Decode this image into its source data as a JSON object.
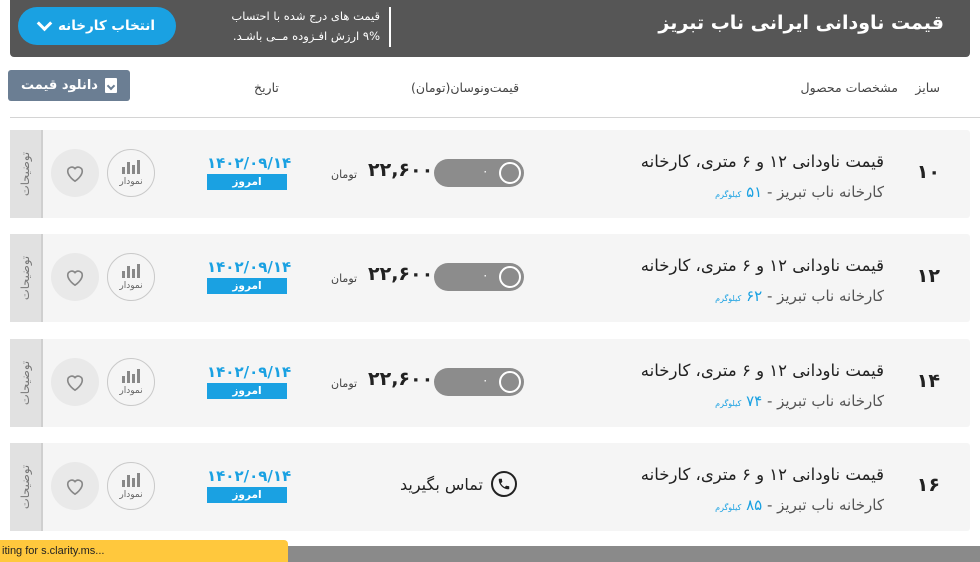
{
  "header": {
    "title": "قیمت ناودانی ایرانی ناب تبریز",
    "note_line1": "قیمت های درج شده با احتساب",
    "note_line2": "۹% ارزش افـزوده مــی باشـد.",
    "factory_button": "انتخاب کارخانه"
  },
  "columns": {
    "size": "سایز",
    "specs": "مشخصات محصول",
    "price": "قیمت‌ونوسان(تومان)",
    "date": "تاریخ",
    "download": "دانلود قیمت"
  },
  "rows": [
    {
      "size": "۱۰",
      "name": "قیمت ناودانی ۱۲ و ۶ متری، کارخانه",
      "factory": "کارخانه ناب تبریز - ",
      "weight": "۵۱",
      "weight_unit": "کیلوگرم",
      "price": "۲۲,۶۰۰",
      "unit": "تومان",
      "change": "۰",
      "date": "۱۴۰۲/۰۹/۱۴",
      "today": "امروز",
      "chart_label": "نمودار",
      "notes": "توضیحات"
    },
    {
      "size": "۱۲",
      "name": "قیمت ناودانی ۱۲ و ۶ متری، کارخانه",
      "factory": "کارخانه ناب تبریز - ",
      "weight": "۶۲",
      "weight_unit": "کیلوگرم",
      "price": "۲۲,۶۰۰",
      "unit": "تومان",
      "change": "۰",
      "date": "۱۴۰۲/۰۹/۱۴",
      "today": "امروز",
      "chart_label": "نمودار",
      "notes": "توضیحات"
    },
    {
      "size": "۱۴",
      "name": "قیمت ناودانی ۱۲ و ۶ متری، کارخانه",
      "factory": "کارخانه ناب تبریز - ",
      "weight": "۷۴",
      "weight_unit": "کیلوگرم",
      "price": "۲۲,۶۰۰",
      "unit": "تومان",
      "change": "۰",
      "date": "۱۴۰۲/۰۹/۱۴",
      "today": "امروز",
      "chart_label": "نمودار",
      "notes": "توضیحات"
    },
    {
      "size": "۱۶",
      "name": "قیمت ناودانی ۱۲ و ۶ متری، کارخانه",
      "factory": "کارخانه ناب تبریز - ",
      "weight": "۸۵",
      "weight_unit": "کیلوگرم",
      "call": "تماس بگیرید",
      "date": "۱۴۰۲/۰۹/۱۴",
      "today": "امروز",
      "chart_label": "نمودار",
      "notes": "توضیحات"
    }
  ],
  "status_bar": {
    "text": "iting for s.clarity.ms..."
  },
  "colors": {
    "accent": "#1aa1e2",
    "header_bg": "#565656",
    "download_bg": "#6b7e93",
    "toggle": "#8c8c8c"
  }
}
